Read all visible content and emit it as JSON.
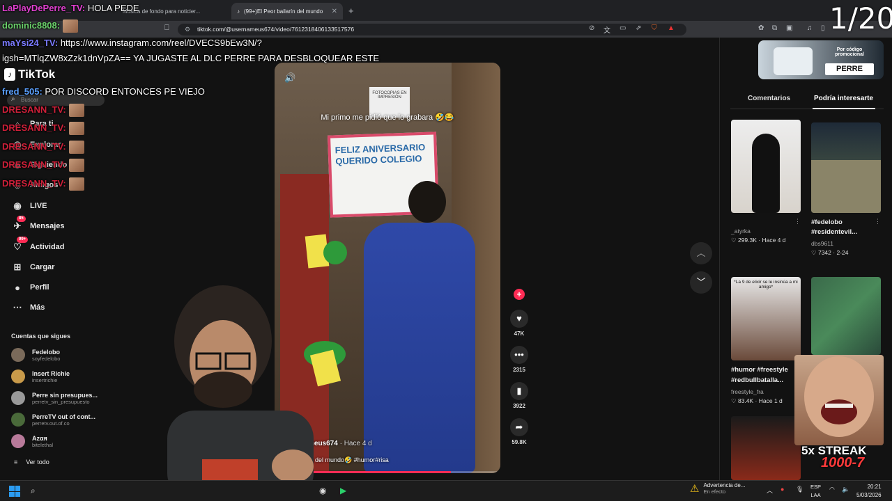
{
  "browser": {
    "tabs": [
      {
        "label": "Música de fondo para noticier...",
        "active": false
      },
      {
        "label": "(99+)El Peor bailarín del mundo",
        "active": true
      }
    ],
    "url": "tiktok.com/@usernameus674/video/7612318406133517576"
  },
  "nav": {
    "logo": "TikTok",
    "search_placeholder": "Buscar",
    "items": [
      {
        "label": "Para ti",
        "icon": "home-icon"
      },
      {
        "label": "Explorar",
        "icon": "compass-icon"
      },
      {
        "label": "Siguiendo",
        "icon": "following-icon"
      },
      {
        "label": "Amigos",
        "icon": "friends-icon"
      },
      {
        "label": "LIVE",
        "icon": "live-icon"
      },
      {
        "label": "Mensajes",
        "icon": "message-icon",
        "badge": "85"
      },
      {
        "label": "Actividad",
        "icon": "activity-icon",
        "badge": "99+"
      },
      {
        "label": "Cargar",
        "icon": "upload-icon"
      },
      {
        "label": "Perfil",
        "icon": "profile-icon"
      },
      {
        "label": "Más",
        "icon": "more-icon"
      }
    ],
    "following_title": "Cuentas que sigues",
    "following": [
      {
        "name": "Fedelobo",
        "handle": "soyfedelobo",
        "color": "#7a6a5a"
      },
      {
        "name": "Insert Richie",
        "handle": "insertrichie",
        "color": "#c89a4a"
      },
      {
        "name": "Perre sin presupues...",
        "handle": "perretv_sin_presupuesto",
        "color": "#9a9a9a"
      },
      {
        "name": "PerreTV out of cont...",
        "handle": "perretv.out.of.co",
        "color": "#4a6a3a"
      },
      {
        "name": "Azαя",
        "handle": "bitelethal",
        "color": "#b87a9a"
      }
    ],
    "see_all": "Ver todo"
  },
  "chat": [
    {
      "user": "LaPlayDePerre_TV:",
      "text": " HOLA PEDE",
      "color": "#e040d0"
    },
    {
      "user": "dominic8808:",
      "text": "",
      "color": "#6ad06a",
      "emote": true
    },
    {
      "user": "maYsi24_TV:",
      "text": " https://www.instagram.com/reel/DVECS9bEw3N/?",
      "color": "#7a7aff"
    },
    {
      "user": "",
      "text": "igsh=MTlqZW8xZzk1dnVpZA== YA JUGASTE AL DLC PERRE PARA DESBLOQUEAR ESTE",
      "color": "#ffffff"
    },
    {
      "user": "fred_505:",
      "text": " POR DISCORD ENTONCES PE VIEJO",
      "color": "#5aa0ff"
    },
    {
      "user": "DRESANN_TV:",
      "text": "",
      "color": "#d0203a",
      "emote": true
    },
    {
      "user": "DRESANN_TV:",
      "text": "",
      "color": "#d0203a",
      "emote": true
    },
    {
      "user": "DRESANN_TV:",
      "text": "",
      "color": "#d0203a",
      "emote": true
    },
    {
      "user": "DRESANN_TV:",
      "text": "",
      "color": "#d0203a",
      "emote": true
    },
    {
      "user": "DRESANN_TV:",
      "text": "",
      "color": "#d0203a",
      "emote": true
    }
  ],
  "video": {
    "caption_top": "Mi primo me pidió que lo grabara 🤣😂",
    "poster_text": "FELIZ ANIVERSARIO QUERIDO COLEGIO",
    "sign_text": "FOTOCOPIAS EN IMPRESIÓN",
    "author": "meus674",
    "age": " · Hace 4 d",
    "desc": "ín del mundo🤣 #humor#risa",
    "progress": 0.78
  },
  "actions": [
    {
      "icon": "heart-icon",
      "glyph": "♥",
      "count": "47K"
    },
    {
      "icon": "comment-icon",
      "glyph": "•••",
      "count": "2315"
    },
    {
      "icon": "bookmark-icon",
      "glyph": "▮",
      "count": "3922"
    },
    {
      "icon": "share-icon",
      "glyph": "➦",
      "count": "59.8K"
    }
  ],
  "promo": {
    "text": "Por código promocional",
    "button": "PERRE"
  },
  "right_tabs": {
    "comments": "Comentarios",
    "suggested": "Podría interesarte"
  },
  "suggestions": [
    {
      "caption1": "",
      "caption2": "",
      "author": "_atyrka",
      "stat": "♡ 299.3K · Hace 4 d"
    },
    {
      "caption1": "#fedelobo",
      "caption2": "#residentevil...",
      "author": "dbs9611",
      "stat": "♡ 7342 · 2-24"
    },
    {
      "caption1": "#humor #freestyle",
      "caption2": "#redbullbatalla...",
      "author": "freestyle_fra",
      "stat": "♡ 83.4K · Hace 1 d"
    },
    {
      "caption1": "",
      "caption2": "",
      "author": "",
      "stat": ""
    }
  ],
  "thumb2_overlay": "*La 9 de elixir se le insinúa a mi amigo*",
  "stream": {
    "counter": "1/20",
    "streak": "5x STREAK",
    "streak_sub": "1000-7"
  },
  "taskbar": {
    "warning_title": "Advertencia de...",
    "warning_sub": "En efecto",
    "lang1": "ESP",
    "lang2": "LAA",
    "time": "20:21",
    "date": "5/03/2026"
  }
}
